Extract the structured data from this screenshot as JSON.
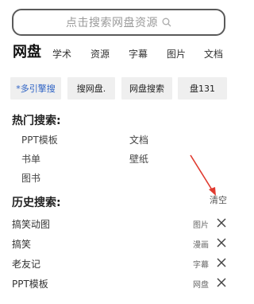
{
  "search": {
    "placeholder": "点击搜索网盘资源"
  },
  "tabs": [
    {
      "label": "网盘",
      "active": true
    },
    {
      "label": "学术"
    },
    {
      "label": "资源"
    },
    {
      "label": "字幕"
    },
    {
      "label": "图片"
    },
    {
      "label": "文档"
    }
  ],
  "engines": [
    {
      "label": "*多引擎搜"
    },
    {
      "label": "搜网盘."
    },
    {
      "label": "网盘搜索"
    },
    {
      "label": "盘131"
    }
  ],
  "hot": {
    "title": "热门搜索:",
    "items": [
      "PPT模板",
      "文档",
      "书单",
      "壁纸",
      "图书"
    ]
  },
  "history": {
    "title": "历史搜索:",
    "clear_label": "清空",
    "items": [
      {
        "text": "搞笑动图",
        "tag": "图片"
      },
      {
        "text": "搞笑",
        "tag": "漫画"
      },
      {
        "text": "老友记",
        "tag": "字幕"
      },
      {
        "text": "PPT模板",
        "tag": "网盘"
      }
    ]
  },
  "colors": {
    "accent": "#2d62c4",
    "arrow": "#e03a2f",
    "chip_bg": "#efefef"
  }
}
